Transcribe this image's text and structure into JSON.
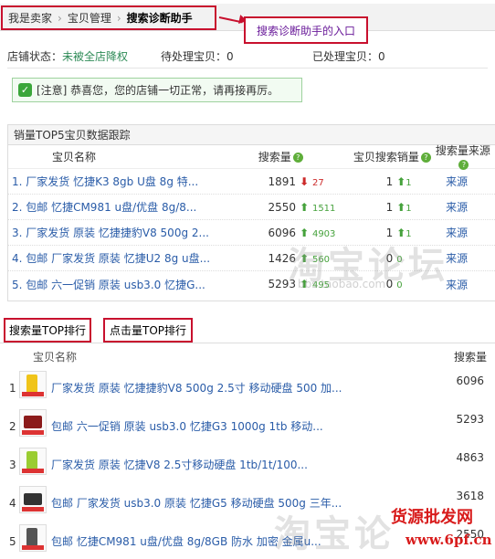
{
  "breadcrumb": {
    "items": [
      "我是卖家",
      "宝贝管理"
    ],
    "current": "搜索诊断助手"
  },
  "callout": "搜索诊断助手的入口",
  "status": {
    "shop_label": "店铺状态：",
    "shop_value": "未被全店降权",
    "pending_label": "待处理宝贝：",
    "pending_value": "0",
    "done_label": "已处理宝贝：",
    "done_value": "0"
  },
  "notice": "[注意] 恭喜您，您的店铺一切正常，请再接再厉。",
  "top5": {
    "title": "销量TOP5宝贝数据跟踪",
    "headers": {
      "name": "宝贝名称",
      "search": "搜索量",
      "hits": "宝贝搜索销量",
      "source": "搜索量来源"
    },
    "rows": [
      {
        "name": "1. 厂家发货 忆捷K3 8gb U盘 8g 特...",
        "search": "1891",
        "trend": "down",
        "delta": "27",
        "hits": "1",
        "hit_delta": "1",
        "source": "来源"
      },
      {
        "name": "2. 包邮 忆捷CM981 u盘/优盘 8g/8...",
        "search": "2550",
        "trend": "up",
        "delta": "1511",
        "hits": "1",
        "hit_delta": "1",
        "source": "来源"
      },
      {
        "name": "3. 厂家发货 原装 忆捷捷豹V8 500g 2...",
        "search": "6096",
        "trend": "up",
        "delta": "4903",
        "hits": "1",
        "hit_delta": "1",
        "source": "来源"
      },
      {
        "name": "4. 包邮 厂家发货 原装 忆捷U2 8g u盘...",
        "search": "1426",
        "trend": "up",
        "delta": "560",
        "hits": "0",
        "hit_delta": "0",
        "source": "来源"
      },
      {
        "name": "5. 包邮 六一促销 原装 usb3.0 忆捷G...",
        "search": "5293",
        "trend": "up",
        "delta": "495",
        "hits": "0",
        "hit_delta": "0",
        "source": "来源"
      }
    ]
  },
  "tabs": {
    "search_rank": "搜索量TOP排行",
    "click_rank": "点击量TOP排行"
  },
  "ranking": {
    "headers": {
      "name": "宝贝名称",
      "search": "搜索量"
    },
    "items": [
      {
        "num": "1",
        "title": "厂家发货 原装 忆捷捷豹V8 500g 2.5寸 移动硬盘 500 加...",
        "value": "6096",
        "color": "#f0c419"
      },
      {
        "num": "2",
        "title": "包邮 六一促销 原装 usb3.0 忆捷G3 1000g 1tb 移动...",
        "value": "5293",
        "color": "#8b1a1a"
      },
      {
        "num": "3",
        "title": "厂家发货 原装 忆捷V8 2.5寸移动硬盘 1tb/1t/100...",
        "value": "4863",
        "color": "#9acd32"
      },
      {
        "num": "4",
        "title": "包邮 厂家发货 usb3.0 原装 忆捷G5 移动硬盘 500g 三年...",
        "value": "3618",
        "color": "#333333"
      },
      {
        "num": "5",
        "title": "包邮 忆捷CM981 u盘/优盘 8g/8GB 防水 加密 金属u...",
        "value": "2550",
        "color": "#555555"
      }
    ]
  },
  "watermarks": {
    "taobao1": "淘宝论坛",
    "taobao1_url": "bbs.taobao.com",
    "taobao2": "淘宝论",
    "site_name": "货源批发网",
    "site_url": "www.6pf.cn"
  }
}
